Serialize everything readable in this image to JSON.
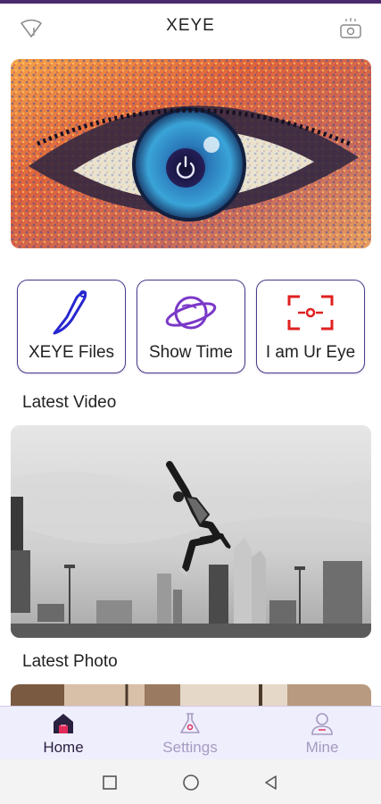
{
  "header": {
    "title": "XEYE",
    "left_icon": "wifi-warning-icon",
    "right_icon": "camera-device-icon"
  },
  "hero": {
    "icon": "power-icon"
  },
  "features": [
    {
      "label": "XEYE Files",
      "icon": "feather-pen-icon"
    },
    {
      "label": "Show Time",
      "icon": "planet-icon"
    },
    {
      "label": "I am Ur Eye",
      "icon": "focus-frame-icon"
    }
  ],
  "sections": {
    "latest_video": "Latest Video",
    "latest_photo": "Latest Photo"
  },
  "tabbar": {
    "items": [
      {
        "label": "Home",
        "icon": "home-icon",
        "active": true
      },
      {
        "label": "Settings",
        "icon": "settings-flask-icon",
        "active": false
      },
      {
        "label": "Mine",
        "icon": "user-icon",
        "active": false
      }
    ]
  },
  "colors": {
    "accent": "#4a3a8a",
    "icon_blue": "#2626d0",
    "icon_purple": "#7a38c8",
    "icon_red": "#e02020",
    "tab_active": "#2a2040",
    "tab_inactive": "#a59ac0",
    "tab_bg": "#efeefd"
  }
}
